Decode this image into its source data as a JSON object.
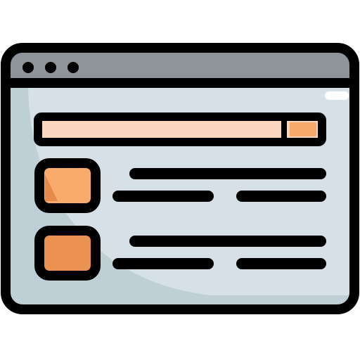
{
  "icon": {
    "name": "browser-window-icon",
    "window_controls": [
      "window-dot-icon",
      "window-dot-icon",
      "window-dot-icon"
    ],
    "search_bar": {
      "name": "search-bar-icon",
      "button": "search-button-icon"
    },
    "list_items": [
      {
        "name": "list-item",
        "thumbnail": "thumbnail-icon"
      },
      {
        "name": "list-item",
        "thumbnail": "thumbnail-icon"
      }
    ]
  },
  "colors": {
    "outline": "#000000",
    "title_bar": "#8e949a",
    "window_body": "#d6e1e7",
    "window_body_shade": "#bfcfd6",
    "title_bar_highlight": "#ffffff",
    "search_field": "#fcd6bf",
    "search_button": "#f7a96c",
    "thumbnail_top": "#f8ab6b",
    "thumbnail_bottom": "#eb9251",
    "thumbnail_shade": "#e68a4a"
  }
}
